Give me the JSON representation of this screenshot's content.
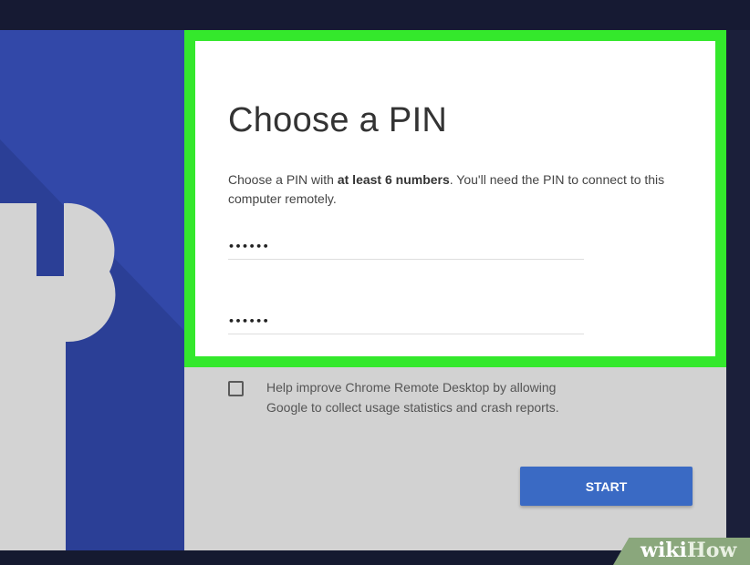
{
  "colors": {
    "side_panel": "#3248a8",
    "highlight_border": "#34e82c",
    "dialog_body": "#d2d2d2",
    "start_button": "#3a6ac4"
  },
  "left_panel": {
    "icon": "wrench-icon"
  },
  "dialog": {
    "title": "Choose a PIN",
    "description": {
      "prefix": "Choose a PIN with ",
      "emphasis": "at least 6 numbers",
      "suffix": ". You'll need the PIN to connect to this computer remotely."
    },
    "pin_field": {
      "value": "••••••"
    },
    "confirm_pin_field": {
      "value": "••••••"
    },
    "consent": {
      "checked": false,
      "label": "Help improve Chrome Remote Desktop by allowing Google to collect usage statistics and crash reports."
    },
    "start_label": "START"
  },
  "watermark": {
    "part1": "wiki",
    "part2": "How"
  }
}
